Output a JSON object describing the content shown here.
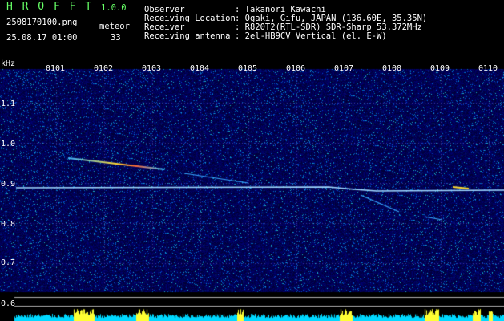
{
  "app": {
    "name": "H R O F F T",
    "version": "1.0.0"
  },
  "file": {
    "name": "2508170100.png",
    "datetime": "25.08.17 01:00",
    "meteor_label": "meteor",
    "meteor_count": "33"
  },
  "info": [
    {
      "label": "Observer",
      "value": ": Takanori Kawachi"
    },
    {
      "label": "Receiving Location",
      "value": ": Ogaki, Gifu, JAPAN (136.60E, 35.35N)"
    },
    {
      "label": "Receiver",
      "value": ": R820T2(RTL-SDR) SDR-Sharp 53.372MHz"
    },
    {
      "label": "Receiving antenna",
      "value": ": 2el-HB9CV Vertical (el. E-W)"
    }
  ],
  "axis": {
    "y_unit": "kHz",
    "y_ticks": [
      "1.1",
      "1.0",
      "0.9",
      "0.8",
      "0.7",
      "0.6"
    ],
    "x_ticks": [
      "0101",
      "0102",
      "0103",
      "0104",
      "0105",
      "0106",
      "0107",
      "0108",
      "0109",
      "0110"
    ]
  },
  "colors": {
    "background": "#000000",
    "spectrogram": "#0a0a5c",
    "carrier": "#9fd8ff",
    "meteor": "#ffdd33",
    "baseline_cyan": "#00d8ff",
    "baseline_yellow": "#ffff33",
    "header_green": "#66ff66"
  }
}
